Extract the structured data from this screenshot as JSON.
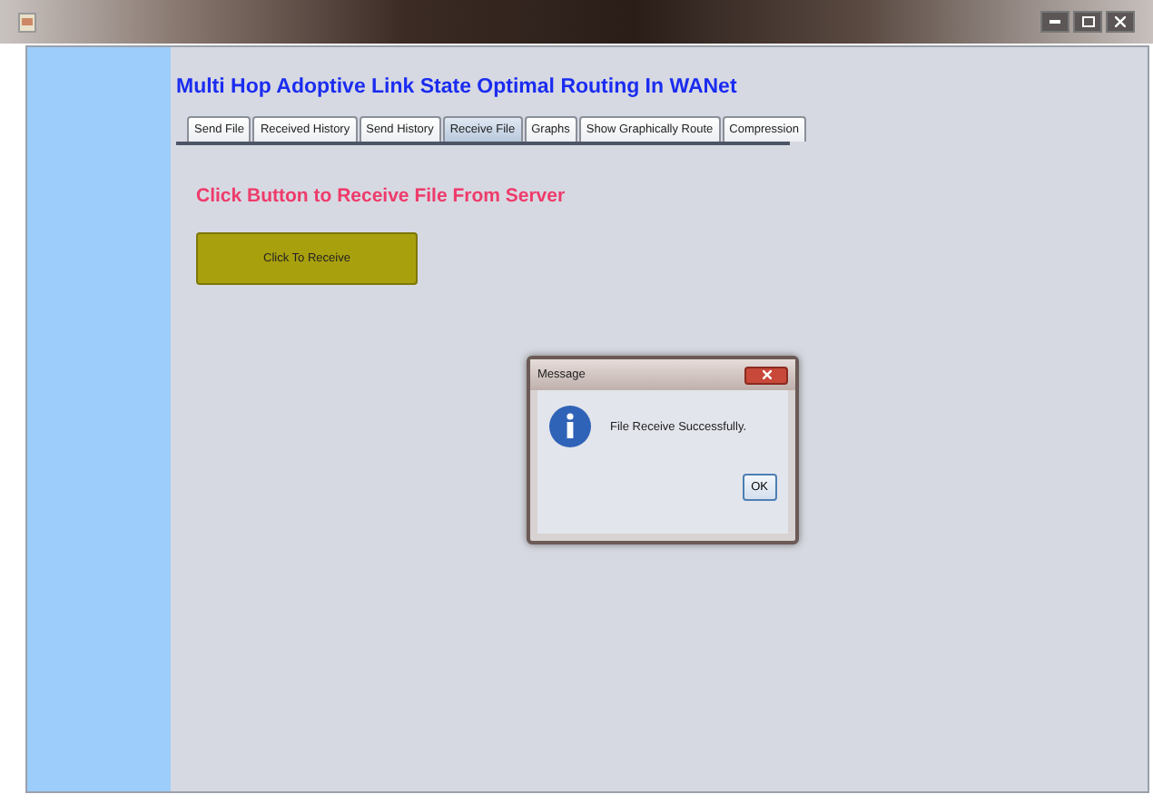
{
  "window": {
    "title": "Multi Hop Adoptive Link State Optimal Routing In WANet"
  },
  "tabs": [
    {
      "label": "Send File",
      "selected": false
    },
    {
      "label": "Received History",
      "selected": false
    },
    {
      "label": "Send History",
      "selected": false
    },
    {
      "label": "Receive File",
      "selected": true
    },
    {
      "label": "Graphs",
      "selected": false
    },
    {
      "label": "Show Graphically Route",
      "selected": false
    },
    {
      "label": "Compression",
      "selected": false
    }
  ],
  "heading": "Click Button to Receive File From Server",
  "receive_button": "Click To Receive",
  "dialog": {
    "title": "Message",
    "message": "File Receive Successfully.",
    "button": "OK"
  }
}
